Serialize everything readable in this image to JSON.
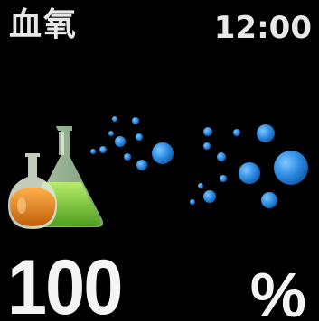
{
  "header": {
    "title": "血氧",
    "time": "12:00"
  },
  "reading": {
    "value": "100",
    "unit": "%"
  },
  "colors": {
    "background": "#000000",
    "text": "#f2f2f2",
    "bubble": "#2e8fe6",
    "flask_liquid_orange": "#e0801c",
    "flask_liquid_green": "#7cc83a"
  },
  "icons": [
    "flasks-icon",
    "bubbles-icon"
  ]
}
